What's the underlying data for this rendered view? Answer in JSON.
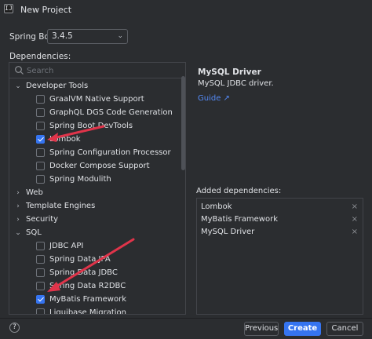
{
  "window": {
    "title": "New Project",
    "app_icon_text": "IJ"
  },
  "spring_boot": {
    "label": "Spring Boot:",
    "value": "3.4.5"
  },
  "dependencies": {
    "label": "Dependencies:",
    "search_placeholder": "Search",
    "tree": [
      {
        "label": "Developer Tools",
        "type": "group",
        "expanded": true
      },
      {
        "label": "GraalVM Native Support",
        "type": "item",
        "checked": false
      },
      {
        "label": "GraphQL DGS Code Generation",
        "type": "item",
        "checked": false
      },
      {
        "label": "Spring Boot DevTools",
        "type": "item",
        "checked": false
      },
      {
        "label": "Lombok",
        "type": "item",
        "checked": true
      },
      {
        "label": "Spring Configuration Processor",
        "type": "item",
        "checked": false
      },
      {
        "label": "Docker Compose Support",
        "type": "item",
        "checked": false
      },
      {
        "label": "Spring Modulith",
        "type": "item",
        "checked": false
      },
      {
        "label": "Web",
        "type": "group",
        "expanded": false
      },
      {
        "label": "Template Engines",
        "type": "group",
        "expanded": false
      },
      {
        "label": "Security",
        "type": "group",
        "expanded": false
      },
      {
        "label": "SQL",
        "type": "group",
        "expanded": true
      },
      {
        "label": "JDBC API",
        "type": "item",
        "checked": false
      },
      {
        "label": "Spring Data JPA",
        "type": "item",
        "checked": false
      },
      {
        "label": "Spring Data JDBC",
        "type": "item",
        "checked": false
      },
      {
        "label": "Spring Data R2DBC",
        "type": "item",
        "checked": false
      },
      {
        "label": "MyBatis Framework",
        "type": "item",
        "checked": true
      },
      {
        "label": "Liquibase Migration",
        "type": "item",
        "checked": false
      }
    ]
  },
  "detail": {
    "title": "MySQL Driver",
    "description": "MySQL JDBC driver.",
    "guide_link": "Guide ↗"
  },
  "added": {
    "label": "Added dependencies:",
    "items": [
      "Lombok",
      "MyBatis Framework",
      "MySQL Driver"
    ],
    "remove_glyph": "×"
  },
  "footer": {
    "help_glyph": "?",
    "previous_label": "Previous",
    "create_label": "Create",
    "cancel_label": "Cancel"
  },
  "colors": {
    "background": "#2b2d30",
    "accent": "#3574f0",
    "link": "#548af7",
    "annotation_arrow": "#e0344a"
  }
}
